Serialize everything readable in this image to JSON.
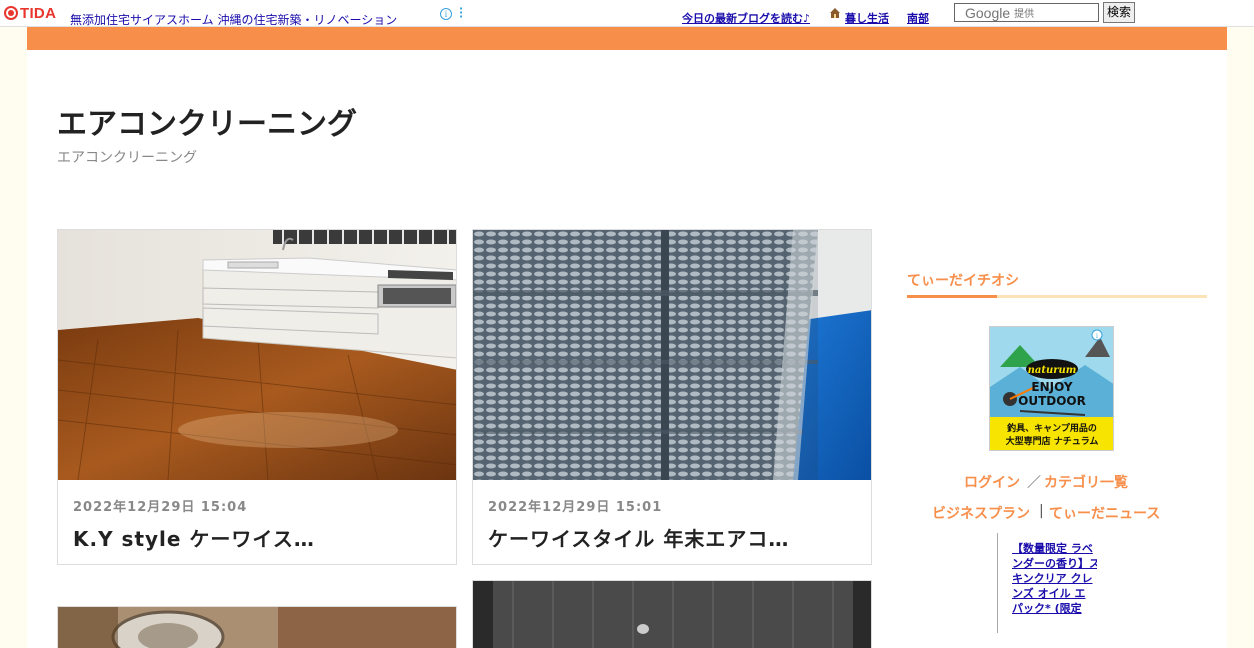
{
  "topbar": {
    "logo_text": "TIDA",
    "ad_text": "無添加住宅サイアスホーム 沖縄の住宅新築・リノベーション",
    "info_glyph": "i",
    "links": {
      "latest_blog": "今日の最新ブログを読む♪",
      "life": "暮し生活",
      "region": "南部"
    },
    "search": {
      "google": "Google",
      "provided": "提供",
      "button": "検索"
    }
  },
  "blog": {
    "title": "エアコンクリーニング",
    "description": "エアコンクリーニング"
  },
  "posts": [
    {
      "date": "2022年12月29日 15:04",
      "title": "K.Y style ケーワイス…"
    },
    {
      "date": "2022年12月29日 15:01",
      "title": "ケーワイスタイル 年末エアコ…"
    }
  ],
  "sidebar": {
    "heading": "てぃーだイチオシ",
    "ad_banner": {
      "brand": "naturum",
      "line1": "ENJOY",
      "line2": "OUTDOOR",
      "caption1": "釣具、キャンプ用品の",
      "caption2": "大型専門店 ナチュラム"
    },
    "links": {
      "login": "ログイン",
      "slash": "／",
      "categories": "カテゴリ一覧",
      "business": "ビジネスプラン",
      "bar": "|",
      "news": "てぃーだニュース"
    },
    "promo_lines": [
      "【数量限定 ラベ",
      "ンダーの香り】ス",
      "キンクリア クレ",
      "ンズ オイル エ",
      "パック* (限定"
    ]
  },
  "colors": {
    "accent": "#f78f4b",
    "accent_light": "#fde3b8",
    "link": "#1a0dab",
    "logo": "#e8362d"
  }
}
